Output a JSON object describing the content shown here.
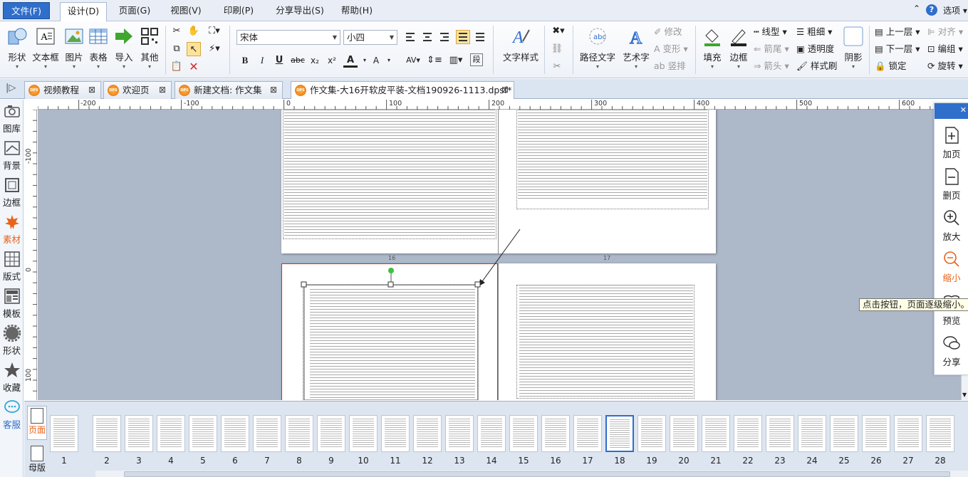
{
  "menubar": {
    "items": [
      "文件(F)",
      "设计(D)",
      "页面(G)",
      "视图(V)",
      "印刷(P)",
      "分享导出(S)",
      "帮助(H)"
    ],
    "options": "选项"
  },
  "ribbon": {
    "big": [
      "形状",
      "文本框",
      "图片",
      "表格",
      "导入",
      "其他"
    ],
    "font_name": "宋体",
    "font_size": "小四",
    "bold": "B",
    "italic": "I",
    "underline": "U",
    "strike": "abc",
    "sub": "x₂",
    "sup": "x²",
    "fontcolor": "A",
    "fontsize_down": "A",
    "wordstyle": "文字样式",
    "pathtext": "路径文字",
    "arttext": "艺术字",
    "modify": "修改",
    "transform": "变形",
    "vertical": "竖排",
    "fill": "填充",
    "border": "边框",
    "linetype": "线型",
    "arrowtail": "箭尾",
    "arrowhead": "箭头",
    "thickness": "粗细",
    "transparency": "透明度",
    "stylebrush": "样式刷",
    "shadow": "阴影",
    "layer_up": "上一层",
    "layer_down": "下一层",
    "lock": "锁定",
    "align": "对齐",
    "group": "编组",
    "rotate": "旋转"
  },
  "tabs": [
    "视频教程",
    "欢迎页",
    "新建文档: 作文集",
    "作文集-大16开软皮平装-文档190926-1113.dpsf*"
  ],
  "leftbar": [
    "图库",
    "背景",
    "边框",
    "素材",
    "版式",
    "模板",
    "形状",
    "收藏",
    "客服"
  ],
  "ruler": {
    "h": [
      "-200",
      "-100",
      "0",
      "100",
      "200",
      "300",
      "400",
      "500",
      "600"
    ],
    "v": [
      "-100",
      "0",
      "100"
    ]
  },
  "canvas": {
    "page_num_left": "16",
    "page_num_right": "17"
  },
  "rightpanel": [
    "加页",
    "删页",
    "放大",
    "缩小",
    "预览",
    "分享"
  ],
  "tooltip": "点击按钮，页面逐级缩小。",
  "pagesbar": {
    "tabs": [
      "页面",
      "母版"
    ],
    "numbers": [
      "1",
      "2",
      "3",
      "4",
      "5",
      "6",
      "7",
      "8",
      "9",
      "10",
      "11",
      "12",
      "13",
      "14",
      "15",
      "16",
      "17",
      "18",
      "19",
      "20",
      "21",
      "22",
      "23",
      "24",
      "25",
      "26",
      "27",
      "28"
    ],
    "selected": "18"
  },
  "colors": {
    "accent": "#2f6ecb",
    "active_left": "#e8631a",
    "selection": "#c0392b"
  }
}
